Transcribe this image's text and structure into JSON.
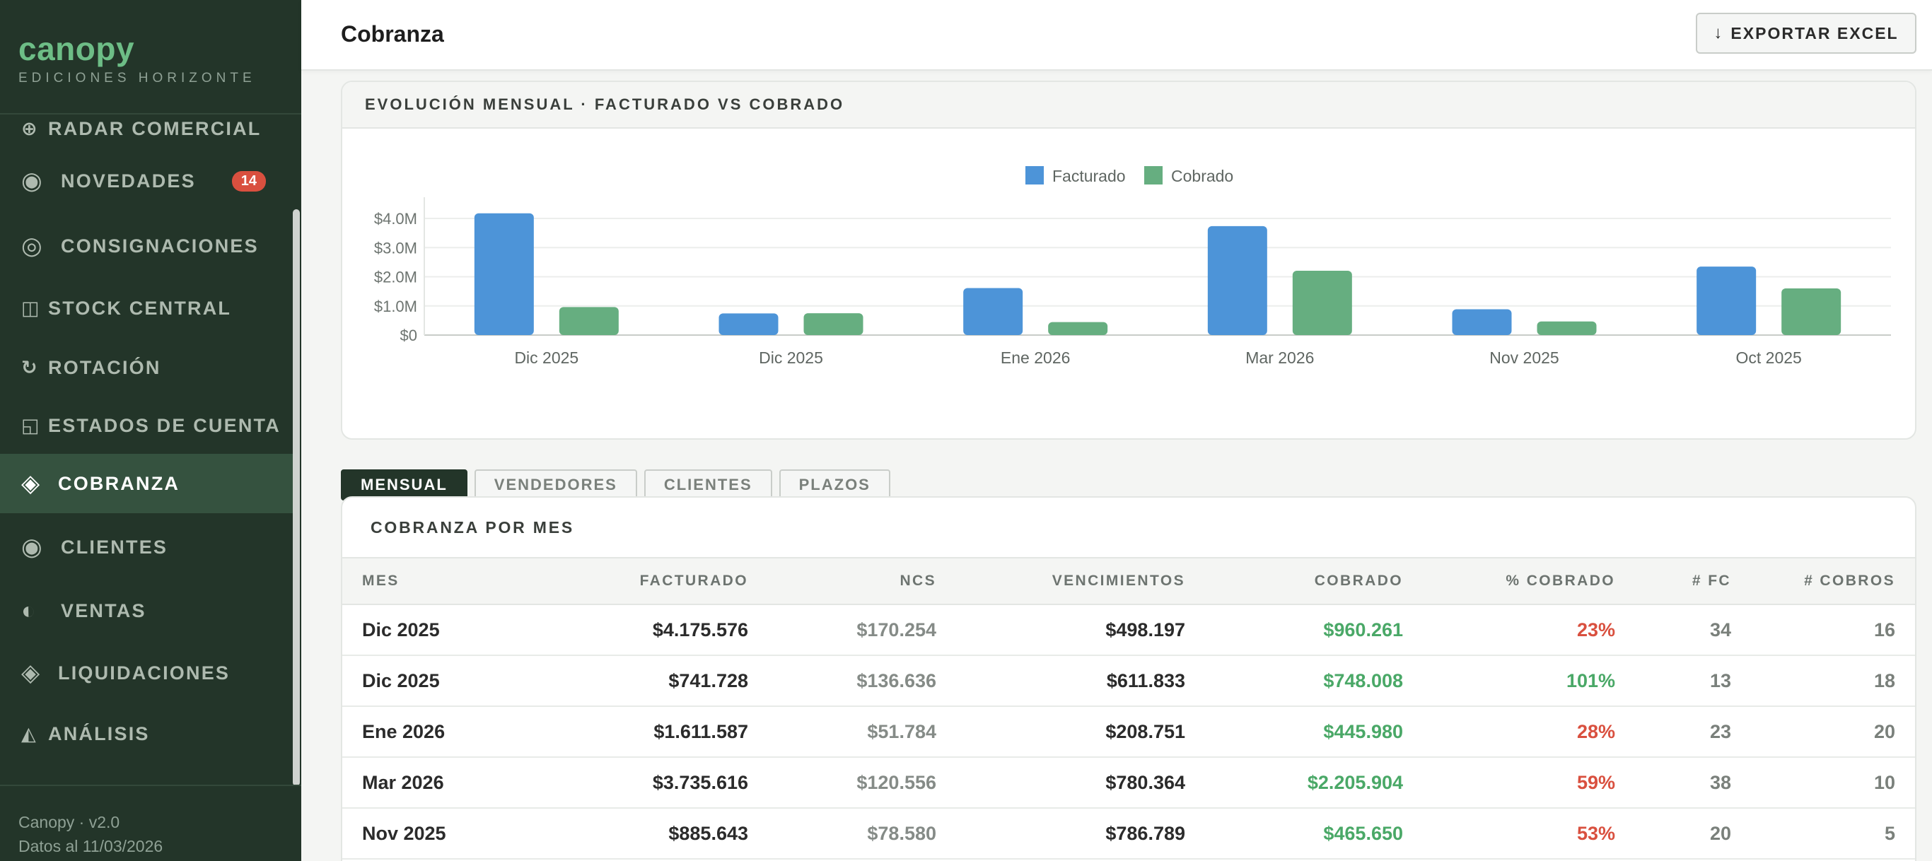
{
  "brand": {
    "name": "canopy",
    "subtitle": "EDICIONES HORIZONTE"
  },
  "sidebar": {
    "items": [
      {
        "icon": "crosshair-icon",
        "glyph": "⊕",
        "label": "RADAR COMERCIAL"
      },
      {
        "icon": "circle-dot-icon",
        "glyph": "◉",
        "label": "NOVEDADES",
        "badge": "14"
      },
      {
        "icon": "ring-icon",
        "glyph": "◎",
        "label": "CONSIGNACIONES"
      },
      {
        "icon": "columns-icon",
        "glyph": "◫",
        "label": "STOCK CENTRAL"
      },
      {
        "icon": "rotate-icon",
        "glyph": "↻",
        "label": "ROTACIÓN"
      },
      {
        "icon": "ledger-icon",
        "glyph": "◱",
        "label": "ESTADOS DE CUENTA"
      },
      {
        "icon": "diamond-icon",
        "glyph": "◈",
        "label": "COBRANZA",
        "active": true
      },
      {
        "icon": "circle-dot-icon",
        "glyph": "◉",
        "label": "CLIENTES"
      },
      {
        "icon": "half-circle-icon",
        "glyph": "◐",
        "label": "VENTAS"
      },
      {
        "icon": "diamond-icon",
        "glyph": "◈",
        "label": "LIQUIDACIONES"
      },
      {
        "icon": "triangle-icon",
        "glyph": "◭",
        "label": "ANÁLISIS"
      }
    ],
    "footer": {
      "version": "Canopy · v2.0",
      "data_date": "Datos al 11/03/2026"
    }
  },
  "header": {
    "title": "Cobranza",
    "export_label": "EXPORTAR EXCEL",
    "export_icon": "arrow-down-icon"
  },
  "chart_card": {
    "title": "EVOLUCIÓN MENSUAL · FACTURADO VS COBRADO"
  },
  "chart_data": {
    "type": "bar",
    "categories": [
      "Dic 2025",
      "Dic 2025",
      "Ene 2026",
      "Mar 2026",
      "Nov 2025",
      "Oct 2025"
    ],
    "series": [
      {
        "name": "Facturado",
        "color": "#4d94d8",
        "values": [
          4175576,
          741728,
          1611587,
          3735616,
          885643,
          2350000
        ]
      },
      {
        "name": "Cobrado",
        "color": "#66ae80",
        "values": [
          960261,
          748008,
          445980,
          2205904,
          465650,
          1600000
        ]
      }
    ],
    "yticks": [
      "$0",
      "$1.0M",
      "$2.0M",
      "$3.0M",
      "$4.0M"
    ],
    "ylim": [
      0,
      4500000
    ],
    "legend": "top-center",
    "grid": true,
    "xlabel": "",
    "ylabel": ""
  },
  "tabs": [
    "MENSUAL",
    "VENDEDORES",
    "CLIENTES",
    "PLAZOS"
  ],
  "table": {
    "title": "COBRANZA POR MES",
    "columns": [
      "MES",
      "FACTURADO",
      "NCS",
      "VENCIMIENTOS",
      "COBRADO",
      "% COBRADO",
      "# FC",
      "# COBROS"
    ],
    "rows": [
      [
        "Dic 2025",
        "$4.175.576",
        "$170.254",
        "$498.197",
        "$960.261",
        "23%",
        "34",
        "16"
      ],
      [
        "Dic 2025",
        "$741.728",
        "$136.636",
        "$611.833",
        "$748.008",
        "101%",
        "13",
        "18"
      ],
      [
        "Ene 2026",
        "$1.611.587",
        "$51.784",
        "$208.751",
        "$445.980",
        "28%",
        "23",
        "20"
      ],
      [
        "Mar 2026",
        "$3.735.616",
        "$120.556",
        "$780.364",
        "$2.205.904",
        "59%",
        "38",
        "10"
      ],
      [
        "Nov 2025",
        "$885.643",
        "$78.580",
        "$786.789",
        "$465.650",
        "53%",
        "20",
        "5"
      ]
    ]
  }
}
